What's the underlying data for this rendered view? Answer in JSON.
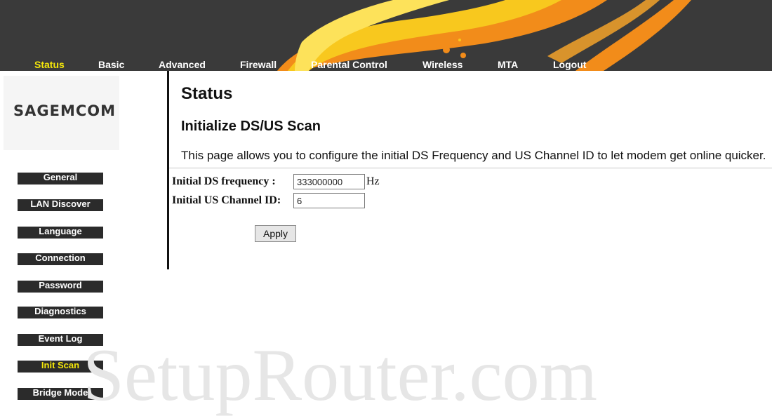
{
  "nav": {
    "items": [
      {
        "label": "Status",
        "active": true
      },
      {
        "label": "Basic",
        "active": false
      },
      {
        "label": "Advanced",
        "active": false
      },
      {
        "label": "Firewall",
        "active": false
      },
      {
        "label": "Parental Control",
        "active": false
      },
      {
        "label": "Wireless",
        "active": false
      },
      {
        "label": "MTA",
        "active": false
      },
      {
        "label": "Logout",
        "active": false
      }
    ]
  },
  "brand": {
    "logo_text": "SAGEMCOM"
  },
  "sidebar": {
    "items": [
      {
        "label": "General",
        "active": false
      },
      {
        "label": "LAN Discover",
        "active": false
      },
      {
        "label": "Language",
        "active": false
      },
      {
        "label": "Connection",
        "active": false
      },
      {
        "label": "Password",
        "active": false
      },
      {
        "label": "Diagnostics",
        "active": false
      },
      {
        "label": "Event Log",
        "active": false
      },
      {
        "label": "Init Scan",
        "active": true
      },
      {
        "label": "Bridge Mode",
        "active": false
      }
    ]
  },
  "main": {
    "title": "Status",
    "section_title": "Initialize DS/US Scan",
    "description": "This page allows you to configure the initial DS Frequency and US Channel ID to let modem get online quicker.",
    "form": {
      "ds_label": "Initial DS frequency :",
      "ds_value": "333000000",
      "ds_unit": "Hz",
      "us_label": "Initial US Channel ID:",
      "us_value": "6",
      "apply_label": "Apply"
    }
  },
  "watermark": "SetupRouter.com",
  "colors": {
    "header_bg": "#3a3a3a",
    "active_text": "#f5e70a",
    "sidebar_button_bg": "#2b2b2b",
    "flame_orange": "#f28c1a",
    "flame_yellow": "#f8c81e"
  }
}
